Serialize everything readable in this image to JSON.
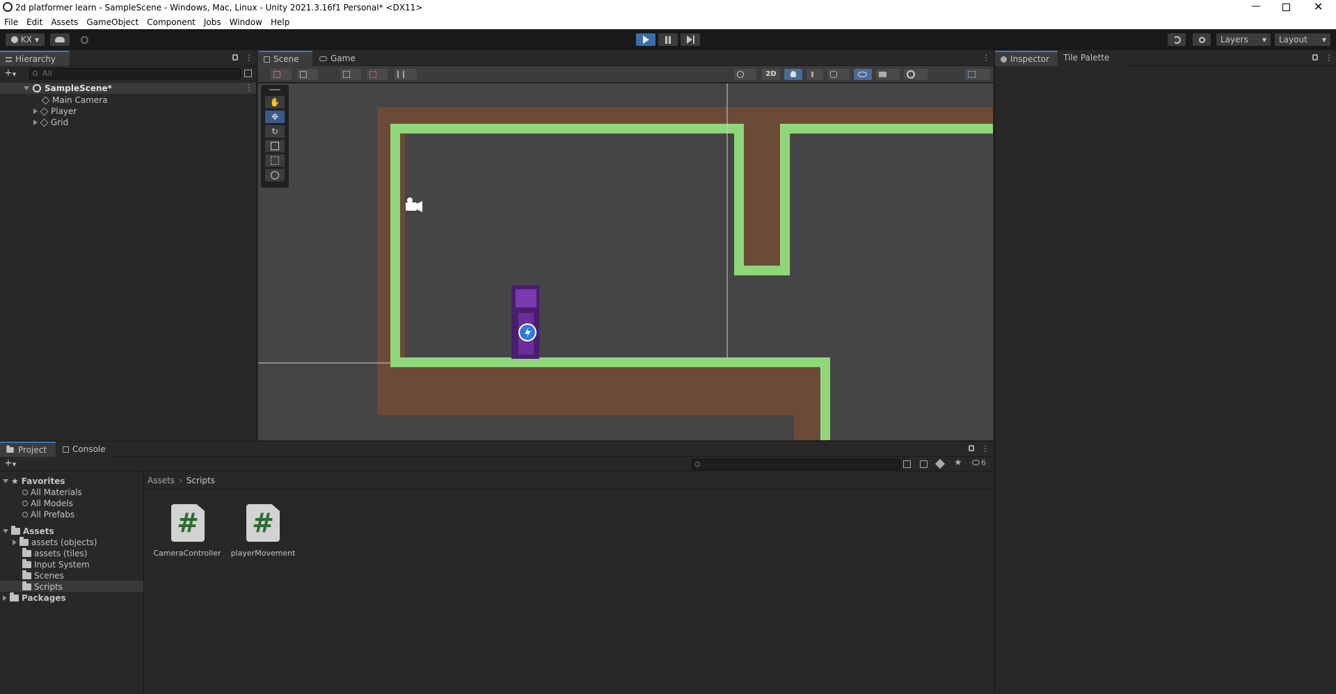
{
  "window": {
    "title": "2d platformer learn - SampleScene - Windows, Mac, Linux - Unity 2021.3.16f1 Personal* <DX11>",
    "controls": [
      "minimize",
      "restore",
      "close"
    ]
  },
  "menu": [
    "File",
    "Edit",
    "Assets",
    "GameObject",
    "Component",
    "Jobs",
    "Window",
    "Help"
  ],
  "toolbar": {
    "account": "KX",
    "layers_label": "Layers",
    "layout_label": "Layout"
  },
  "hierarchy": {
    "tab": "Hierarchy",
    "search_placeholder": "All",
    "scene": "SampleScene*",
    "items": [
      "Main Camera",
      "Player",
      "Grid"
    ]
  },
  "scene_view": {
    "tabs": [
      "Scene",
      "Game"
    ],
    "mode_2d": "2D"
  },
  "inspector": {
    "tabs": [
      "Inspector",
      "Tile Palette"
    ]
  },
  "project": {
    "tabs": [
      "Project",
      "Console"
    ],
    "favorites_label": "Favorites",
    "favorites": [
      "All Materials",
      "All Models",
      "All Prefabs"
    ],
    "assets_label": "Assets",
    "asset_folders": [
      "assets (objects)",
      "assets (tiles)",
      "Input System",
      "Scenes",
      "Scripts"
    ],
    "packages_label": "Packages",
    "breadcrumb": [
      "Assets",
      "Scripts"
    ],
    "files": [
      "CameraController",
      "playerMovement"
    ],
    "hidden_count": "6"
  }
}
